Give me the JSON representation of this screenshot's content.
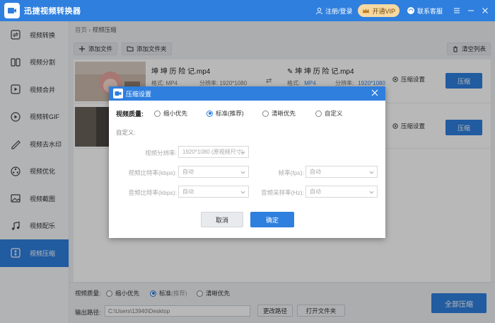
{
  "app": {
    "title": "迅捷视频转换器"
  },
  "titlebar": {
    "login": "注册/登录",
    "vip": "开通VIP",
    "service": "联系客服"
  },
  "sidebar": {
    "items": [
      {
        "label": "视频转换",
        "icon": "convert-icon"
      },
      {
        "label": "视频分割",
        "icon": "split-icon"
      },
      {
        "label": "视频合并",
        "icon": "merge-icon"
      },
      {
        "label": "视频转GIF",
        "icon": "gif-icon"
      },
      {
        "label": "视频去水印",
        "icon": "watermark-icon"
      },
      {
        "label": "视频优化",
        "icon": "optimize-icon"
      },
      {
        "label": "视频截图",
        "icon": "screenshot-icon"
      },
      {
        "label": "视频配乐",
        "icon": "music-icon"
      },
      {
        "label": "视频压缩",
        "icon": "compress-icon",
        "active": true
      }
    ]
  },
  "breadcrumb": {
    "home": "首页",
    "sep": "›",
    "current": "视频压缩"
  },
  "toolbar": {
    "add_file": "添加文件",
    "add_folder": "添加文件夹",
    "clear": "清空列表"
  },
  "files": [
    {
      "name": "坤 坤 历 险 记.mp4",
      "output_name": "坤 坤 历 险 记.mp4",
      "format_label": "格式:",
      "format": "MP4",
      "res_label": "分辨率:",
      "resolution": "1920*1080",
      "out_format": "MP4",
      "out_resolution": "1920*1080",
      "settings": "压缩设置",
      "action": "压缩"
    },
    {
      "settings": "压缩设置",
      "action": "压缩"
    }
  ],
  "bottom": {
    "quality_label": "视频质量:",
    "q_small": "缩小优先",
    "q_standard": "标准",
    "q_standard_sub": "(推荐)",
    "q_clear": "清晰优先",
    "path_label": "输出路径:",
    "path": "C:\\Users\\13940\\Desktop",
    "change_path": "更改路径",
    "open_folder": "打开文件夹",
    "compress_all": "全部压缩"
  },
  "dialog": {
    "title": "压缩设置",
    "quality_label": "视频质量:",
    "options": [
      "缩小优先",
      "标准(推荐)",
      "清晰优先",
      "自定义"
    ],
    "selected": 1,
    "custom_label": "自定义:",
    "resolution_label": "视频分辨率:",
    "resolution_value": "1920*1080 (原视频尺寸)",
    "bitrate_label": "视频比特率(kbps):",
    "bitrate_value": "自动",
    "fps_label": "帧率(fps):",
    "fps_value": "自动",
    "audio_bitrate_label": "音频比特率(kbps):",
    "audio_bitrate_value": "自动",
    "sample_rate_label": "音频采样率(Hz):",
    "sample_rate_value": "自动",
    "cancel": "取消",
    "ok": "确定"
  },
  "colors": {
    "accent": "#2f7fde",
    "vip": "#f6d9a2"
  }
}
